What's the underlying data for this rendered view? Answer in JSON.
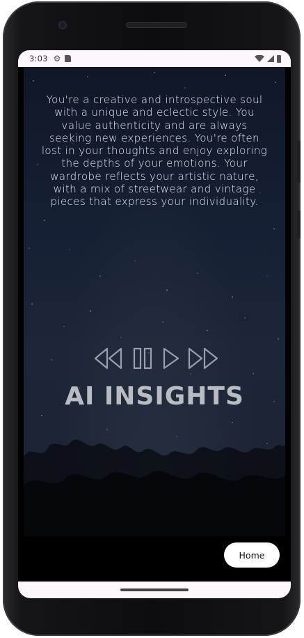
{
  "status_bar": {
    "time": "3:03",
    "icons": [
      "gear-icon",
      "sd-card-icon",
      "wifi-icon",
      "cell-signal-icon",
      "battery-icon"
    ]
  },
  "insight": {
    "text": "You're a creative and introspective soul with a unique and eclectic style. You value authenticity and are always seeking new experiences. You're often lost in your thoughts and enjoy exploring the depths of your emotions. Your wardrobe reflects your artistic nature, with a mix of streetwear and vintage pieces that express your individuality."
  },
  "media_controls": {
    "icons": [
      "rewind-icon",
      "pause-icon",
      "play-icon",
      "fast-forward-icon"
    ]
  },
  "title": "AI INSIGHTS",
  "home_button": {
    "label": "Home"
  },
  "colors": {
    "background_night": "#162034",
    "text_light": "#e3e6ee",
    "title_gray": "#b9bcc3",
    "status_bar_bg": "#fdf7fd"
  }
}
